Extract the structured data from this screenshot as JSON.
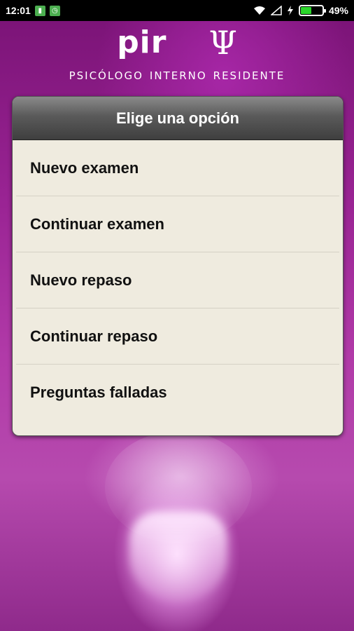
{
  "status_bar": {
    "time": "12:01",
    "battery_percent": "49%",
    "battery_level": 0.49,
    "icons": [
      "sim-icon",
      "alarm-icon",
      "wifi-icon",
      "signal-icon",
      "charging-icon",
      "battery-icon"
    ],
    "battery_color": "#2bd62b"
  },
  "logo": {
    "wordmark": "pir",
    "symbol": "Ψ",
    "subtitle": "psicólogo interno residente"
  },
  "dialog": {
    "title": "Elige una opción",
    "options": [
      "Nuevo examen",
      "Continuar examen",
      "Nuevo repaso",
      "Continuar repaso",
      "Preguntas falladas"
    ]
  },
  "colors": {
    "background": "#9a2494",
    "dialog_body": "#efebdf",
    "dialog_header": "#4a4a4a"
  }
}
